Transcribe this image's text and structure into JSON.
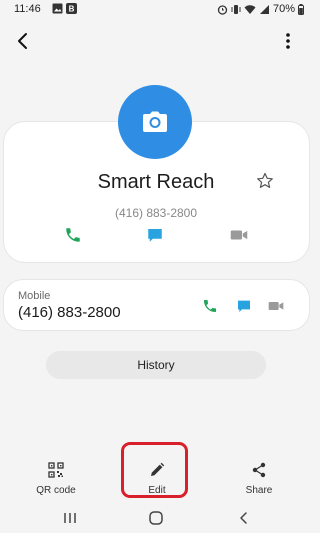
{
  "status_bar": {
    "time": "11:46",
    "battery": "70%"
  },
  "contact": {
    "name": "Smart Reach",
    "phone_display": "(416) 883-2800"
  },
  "mobile": {
    "label": "Mobile",
    "number": "(416) 883-2800"
  },
  "history_label": "History",
  "bottom_actions": {
    "qr_label": "QR code",
    "edit_label": "Edit",
    "share_label": "Share"
  },
  "colors": {
    "avatar": "#2f8de4",
    "call": "#1fa55a",
    "message": "#29a3e0",
    "video": "#9a9a9a",
    "highlight": "#d81f2a"
  }
}
